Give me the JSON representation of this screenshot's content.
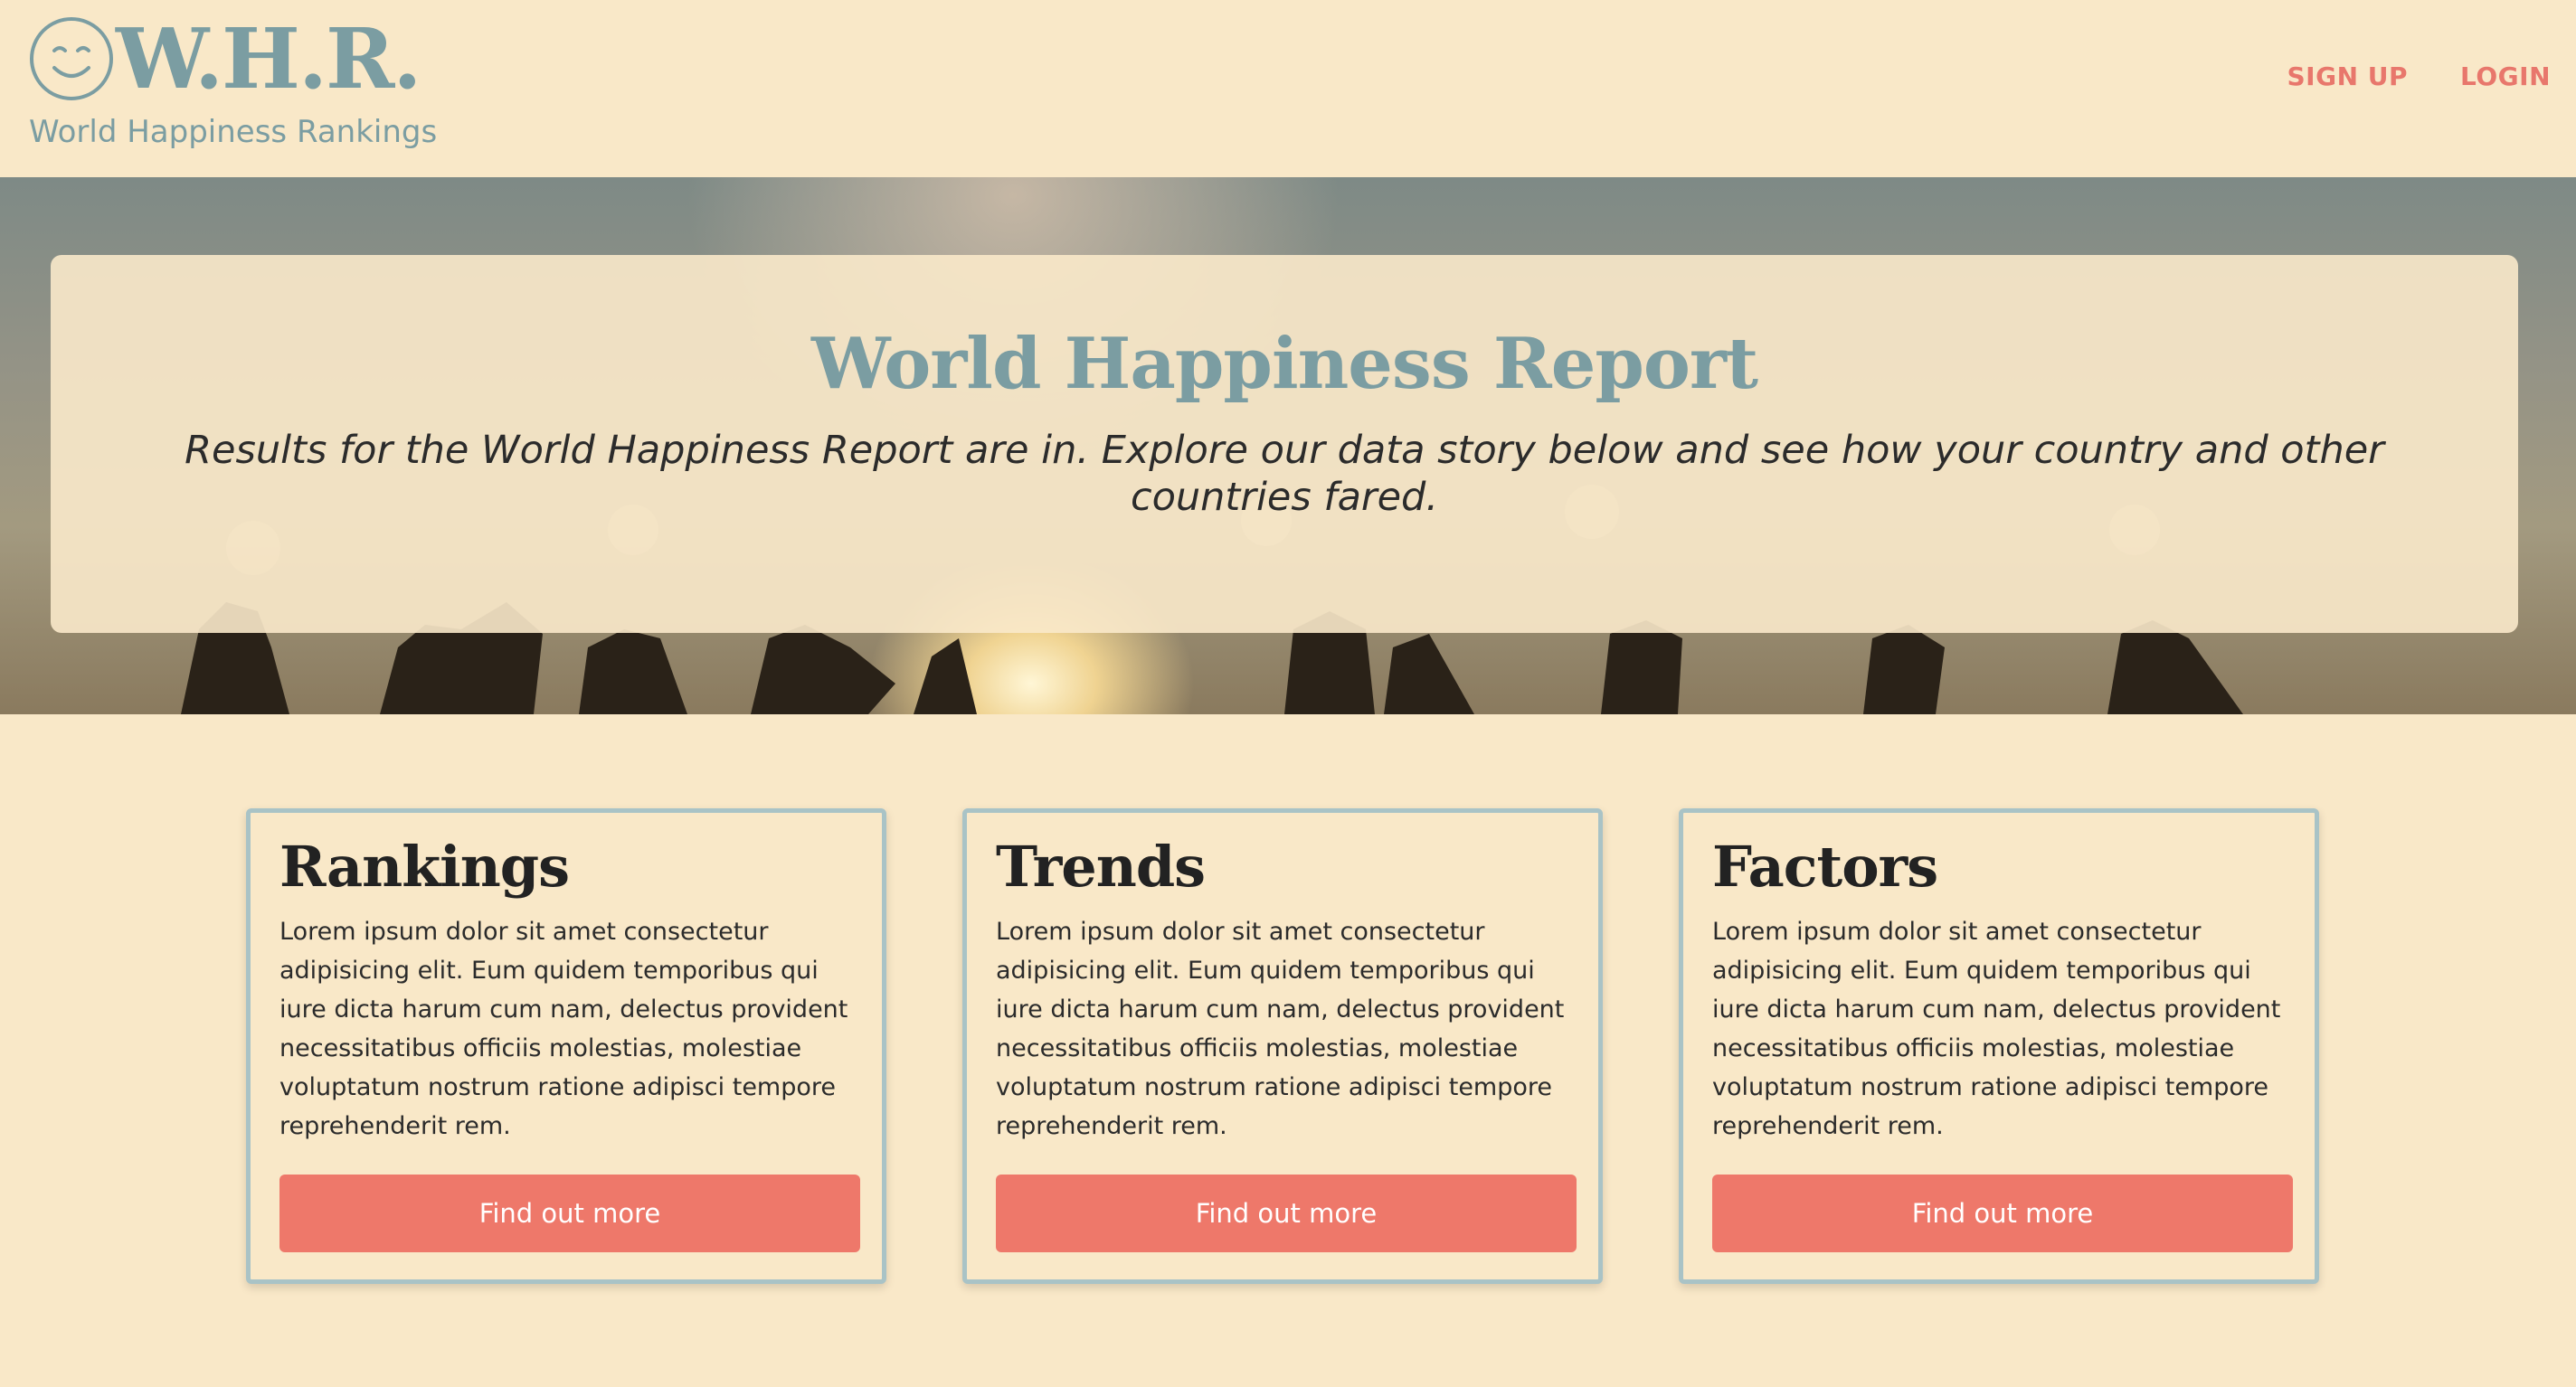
{
  "brand": {
    "mark": "W.H.R.",
    "tagline": "World Happiness Rankings",
    "icon": "smiley-icon"
  },
  "nav": {
    "signup_label": "SIGN UP",
    "login_label": "LOGIN"
  },
  "hero": {
    "title": "World Happiness Report",
    "subtitle": "Results for the World Happiness Report are in. Explore our data story below and see how your country and other countries fared."
  },
  "cards": [
    {
      "title": "Rankings",
      "body": "Lorem ipsum dolor sit amet consectetur adipisicing elit. Eum quidem temporibus qui iure dicta harum cum nam, delectus provident necessitatibus officiis molestias, molestiae voluptatum nostrum ratione adipisci tempore reprehenderit rem.",
      "button_label": "Find out more"
    },
    {
      "title": "Trends",
      "body": "Lorem ipsum dolor sit amet consectetur adipisicing elit. Eum quidem temporibus qui iure dicta harum cum nam, delectus provident necessitatibus officiis molestias, molestiae voluptatum nostrum ratione adipisci tempore reprehenderit rem.",
      "button_label": "Find out more"
    },
    {
      "title": "Factors",
      "body": "Lorem ipsum dolor sit amet consectetur adipisicing elit. Eum quidem temporibus qui iure dicta harum cum nam, delectus provident necessitatibus officiis molestias, molestiae voluptatum nostrum ratione adipisci tempore reprehenderit rem.",
      "button_label": "Find out more"
    }
  ],
  "colors": {
    "background": "#f9e8c8",
    "brand": "#7b9da2",
    "accent": "#ee786a",
    "card_border": "#a9c3c6"
  }
}
